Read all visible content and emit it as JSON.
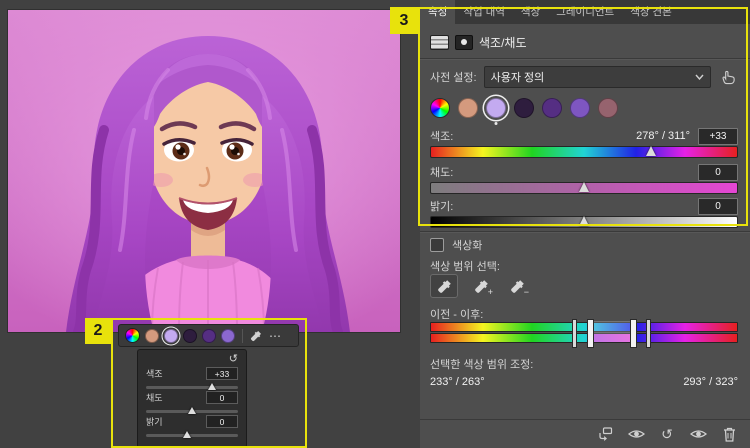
{
  "annotations": {
    "label_2": "2",
    "label_3": "3",
    "highlight_color": "#e8e20c"
  },
  "icons": {
    "more_options": "⋯",
    "reset": "↺"
  },
  "properties_panel": {
    "tabs": [
      {
        "label": "속성"
      },
      {
        "label": "작업 내역"
      },
      {
        "label": "색상"
      },
      {
        "label": "그레이디언트"
      },
      {
        "label": "색상 견본"
      }
    ],
    "adjustment_title": "색조/채도",
    "preset_label": "사전 설정:",
    "preset_value": "사용자 정의",
    "swatches": [
      "#d49a7e",
      "#c3aaf0",
      "#2e1d3e",
      "#552e83",
      "#7e56c1",
      "#96636e"
    ],
    "hue": {
      "label": "색조:",
      "range": "278° / 311°",
      "value": "+33",
      "thumb_pct": 72
    },
    "saturation": {
      "label": "채도:",
      "value": "0",
      "thumb_pct": 50
    },
    "lightness": {
      "label": "밝기:",
      "value": "0",
      "thumb_pct": 50
    },
    "colorize_label": "색상화",
    "color_range_label": "색상 범위 선택:",
    "before_after_label": "이전 - 이후:",
    "adjusted_range_label": "선택한 색상 범위 조정:",
    "adjusted_range_left": "233° / 263°",
    "adjusted_range_right": "293° / 323°"
  },
  "mini_panel": {
    "swatches": [
      "#d49a7e",
      "#c3aaf0",
      "#2e1d3e",
      "#552e83",
      "#8b68cf"
    ],
    "rows": [
      {
        "label": "색조",
        "value": "+33",
        "thumb_pct": 72
      },
      {
        "label": "채도",
        "value": "0",
        "thumb_pct": 50
      },
      {
        "label": "밝기",
        "value": "0",
        "thumb_pct": 45
      }
    ]
  }
}
